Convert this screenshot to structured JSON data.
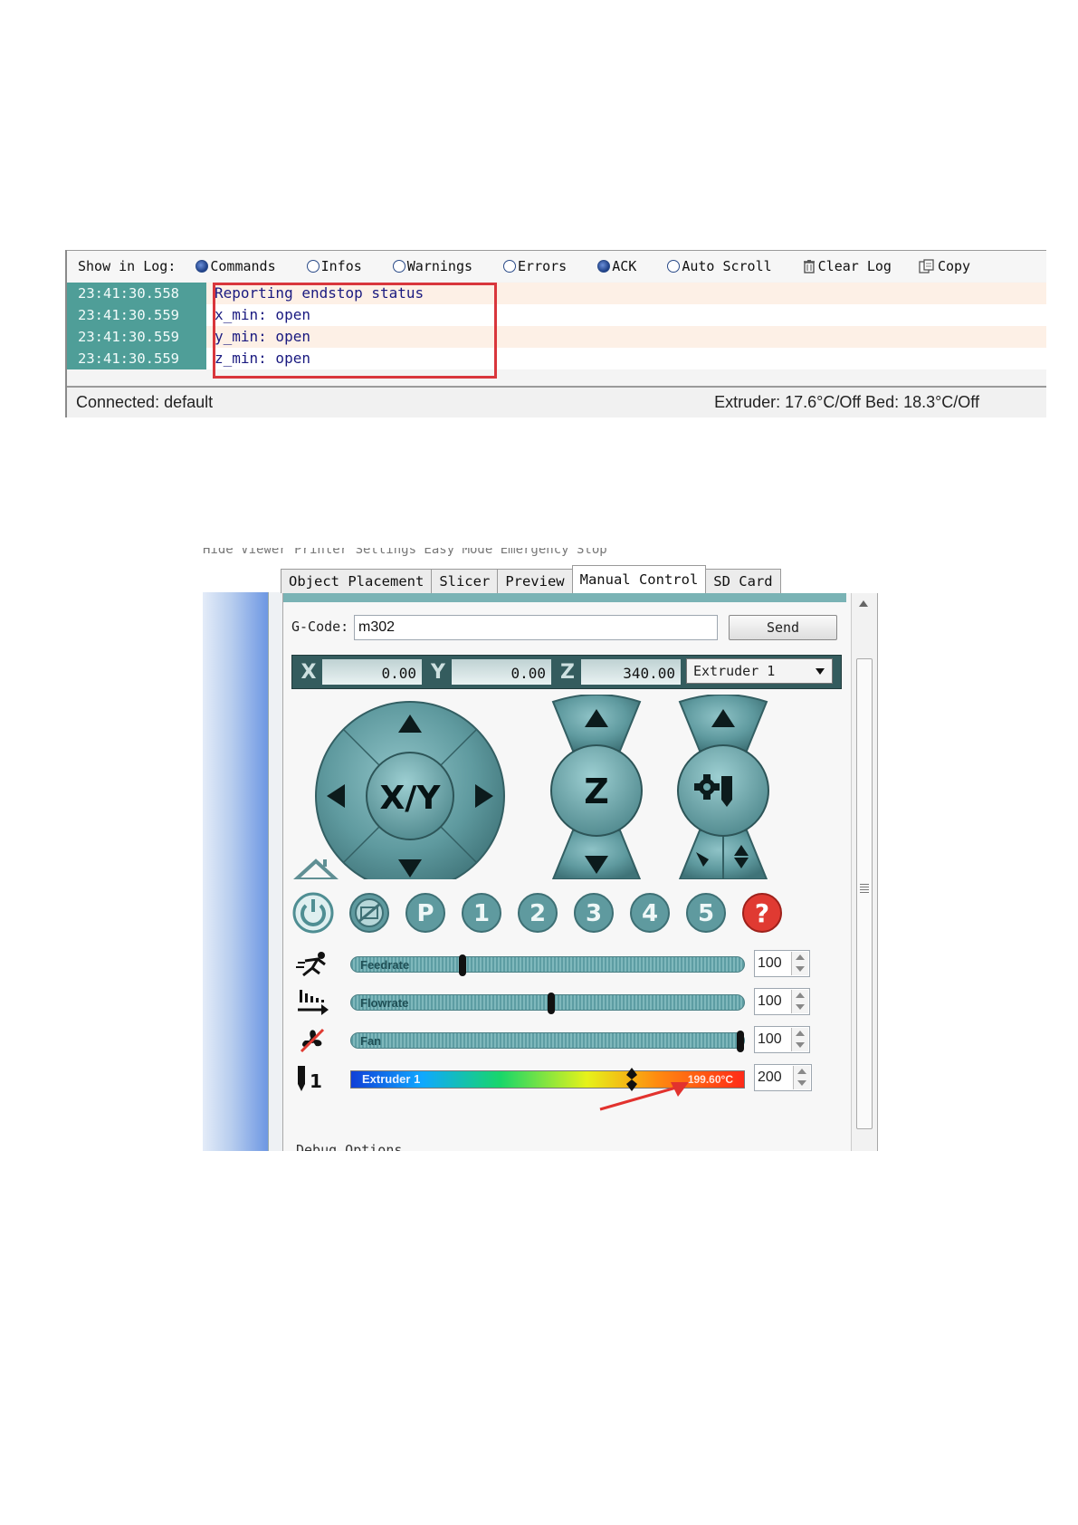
{
  "log": {
    "show_label": "Show in Log:",
    "options": [
      {
        "label": "Commands",
        "checked": true
      },
      {
        "label": "Infos",
        "checked": false
      },
      {
        "label": "Warnings",
        "checked": false
      },
      {
        "label": "Errors",
        "checked": false
      },
      {
        "label": "ACK",
        "checked": true
      },
      {
        "label": "Auto Scroll",
        "checked": false
      }
    ],
    "clear_label": "Clear Log",
    "copy_label": "Copy",
    "entries": [
      {
        "time": "23:41:30.558",
        "text": "Reporting endstop status"
      },
      {
        "time": "23:41:30.559",
        "text": "x_min: open"
      },
      {
        "time": "23:41:30.559",
        "text": "y_min: open"
      },
      {
        "time": "23:41:30.559",
        "text": "z_min: open"
      }
    ],
    "status_left": "Connected: default",
    "status_right": "Extruder: 17.6°C/Off Bed: 18.3°C/Off"
  },
  "manual": {
    "top_clipped": "Hide Viewer        Printer Settings  Easy Mode  Emergency Stop",
    "tabs": [
      {
        "label": "Object Placement",
        "active": false
      },
      {
        "label": "Slicer",
        "active": false
      },
      {
        "label": "Preview",
        "active": false
      },
      {
        "label": "Manual Control",
        "active": true
      },
      {
        "label": "SD Card",
        "active": false
      }
    ],
    "gcode_label": "G-Code:",
    "gcode_value": "m302",
    "send_label": "Send",
    "coords": [
      {
        "axis": "X",
        "value": "0.00"
      },
      {
        "axis": "Y",
        "value": "0.00"
      },
      {
        "axis": "Z",
        "value": "340.00"
      }
    ],
    "extruder_select": "Extruder 1",
    "jog_xy_label": "X/Y",
    "jog_z_label": "Z",
    "buttons": [
      "P",
      "1",
      "2",
      "3",
      "4",
      "5",
      "?"
    ],
    "sliders": [
      {
        "label": "Feedrate",
        "value": "100",
        "position": 0.28
      },
      {
        "label": "Flowrate",
        "value": "100",
        "position": 0.51
      },
      {
        "label": "Fan",
        "value": "100",
        "position": 1.0
      }
    ],
    "extruder_row": {
      "index": "1",
      "label": "Extruder 1",
      "current": "199.60°C",
      "target": "200",
      "position": 0.72
    },
    "bottom_clipped": "Debug Options",
    "colors": {
      "accent": "#7ab3b5",
      "log_time_bg": "#4f9e98",
      "highlight": "#d9363c",
      "jog": "#5f9a9f"
    }
  }
}
